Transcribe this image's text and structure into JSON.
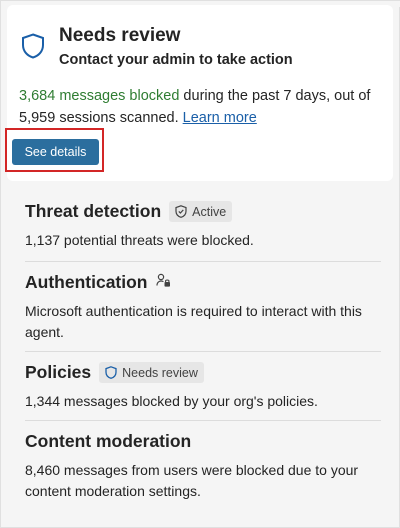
{
  "header": {
    "title": "Needs review",
    "subtitle": "Contact your admin to take action",
    "icon": "shield-icon",
    "accent": "#1a5fa8"
  },
  "stats": {
    "blocked_text": "3,684 messages blocked",
    "rest_text": " during the past 7 days, out of 5,959 sessions scanned. ",
    "learn_more": "Learn more",
    "highlight_color": "#2f7d32"
  },
  "details_button": {
    "label": "See details",
    "color": "#2b6e9e"
  },
  "sections": [
    {
      "title": "Threat detection",
      "badge": "Active",
      "badge_icon": "shield-check-icon",
      "body": "1,137 potential threats were blocked."
    },
    {
      "title": "Authentication",
      "icon": "lock-person-icon",
      "body": "Microsoft authentication is required to interact with this agent."
    },
    {
      "title": "Policies",
      "badge": "Needs review",
      "badge_icon": "shield-icon",
      "body": "1,344 messages blocked by your org's policies."
    },
    {
      "title": "Content moderation",
      "body": "8,460 messages from users were blocked due to your content moderation settings."
    }
  ]
}
